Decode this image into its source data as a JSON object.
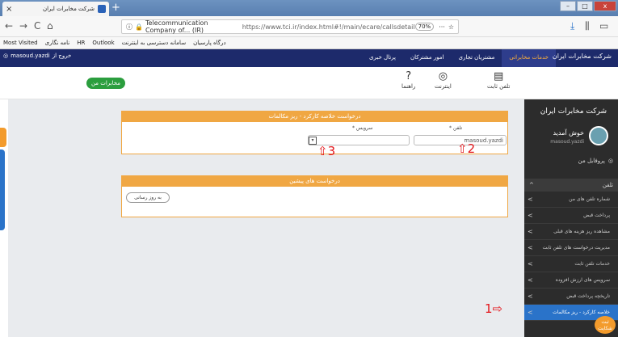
{
  "browser": {
    "tab_title": "شرکت مخابرات ایران",
    "tab_close": "×",
    "new_tab": "+",
    "win_min": "–",
    "win_max": "□",
    "win_close": "x",
    "nav_back": "←",
    "nav_forward": "→",
    "nav_reload": "C",
    "nav_home": "⌂",
    "url_site": "Telecommunication Company of... (IR)",
    "url_path": "https://www.tci.ir/index.html#!/main/ecare/callsdetail",
    "zoom": "70%",
    "bookmarks": [
      "Most Visited",
      "نامه نگاری",
      "HR",
      "Outlook",
      "سامانه دسترسی به اینترنت",
      "درگاه پارسیان"
    ]
  },
  "site": {
    "user": "masoud.yazdi",
    "logout": "خروج از",
    "menu": [
      "خدمات مخابراتی",
      "مشتریان تجاری",
      "امور مشترکان",
      "پرتال خبری"
    ],
    "logo": "شرکت مخابرات ایران",
    "subnav": [
      {
        "label": "تلفن ثابت",
        "icon": "▤"
      },
      {
        "label": "اینترنت",
        "icon": "◎"
      },
      {
        "label": "راهنما",
        "icon": "?"
      }
    ],
    "my_comm_button": "مخابرات من"
  },
  "panel1": {
    "title": "درخواست خلاصه کارکرد - ریز مکالمات",
    "phone_label": "تلفن *",
    "phone_value": "masoud.yazdi",
    "service_label": "سرویس *",
    "service_value": ""
  },
  "panel2": {
    "title": "درخواست های پیشین",
    "refresh_button": "به روز رسانی"
  },
  "sidebar": {
    "brand": "شرکت مخابرات ایران",
    "welcome": "خوش آمدید",
    "welcome_sub": "masoud.yazdi",
    "profile": "پروفایل من",
    "phone_section": "تلفن",
    "items": [
      "شماره تلفن های من",
      "پرداخت قبض",
      "مشاهده ریز هزینه های قبلی",
      "مدیریت درخواست های تلفن ثابت",
      "خدمات تلفن ثابت",
      "سرویس های ارزش افزوده",
      "تاریخچه پرداخت قبض",
      "خلاصه کارکرد - ریز مکالمات"
    ],
    "fab": "ثبت شکایت"
  },
  "annotations": {
    "a1": "1⇨",
    "a2": "⇧2",
    "a3": "⇧3"
  }
}
